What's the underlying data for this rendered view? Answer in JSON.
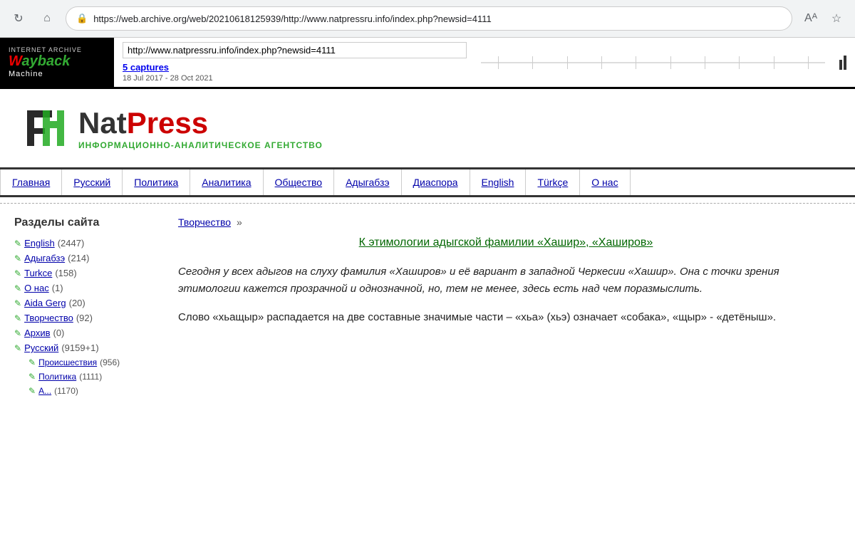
{
  "browser": {
    "url": "https://web.archive.org/web/20210618125939/http://www.natpressru.info/index.php?newsid=4111",
    "address_display": "https://web.archive.org/web/20210618125939/http://www.natpressru.info/index.php?newsid=4111"
  },
  "wayback": {
    "internet_archive": "INTERNET ARCHIVE",
    "logo_w": "W",
    "logo_ayback": "ayback",
    "logo_machine": "Machine",
    "url_field": "http://www.natpressru.info/index.php?newsid=4111",
    "captures_label": "5 captures",
    "date_range": "18 Jul 2017 - 28 Oct 2021"
  },
  "site": {
    "logo_nat": "Nat",
    "logo_press": "Press",
    "subtitle": "ИНФОРМАЦИОННО-АНАЛИТИЧЕСКОЕ АГЕНТСТВО"
  },
  "nav": {
    "items": [
      {
        "label": "Главная"
      },
      {
        "label": "Русский"
      },
      {
        "label": "Политика"
      },
      {
        "label": "Аналитика"
      },
      {
        "label": "Общество"
      },
      {
        "label": "Адыгабзэ"
      },
      {
        "label": "Диаспора"
      },
      {
        "label": "English"
      },
      {
        "label": "Türkçe"
      },
      {
        "label": "О нас"
      }
    ]
  },
  "sidebar": {
    "title": "Разделы сайта",
    "items": [
      {
        "label": "English",
        "count": "(2447)"
      },
      {
        "label": "Адыгабзэ",
        "count": "(214)"
      },
      {
        "label": "Turkce",
        "count": "(158)"
      },
      {
        "label": "О нас",
        "count": "(1)"
      },
      {
        "label": "Aida Gerg",
        "count": "(20)"
      },
      {
        "label": "Творчество",
        "count": "(92)"
      },
      {
        "label": "Архив",
        "count": "(0)"
      },
      {
        "label": "Русский",
        "count": "(9159+1)"
      }
    ],
    "sub_items": [
      {
        "label": "Происшествия",
        "count": "(956)"
      },
      {
        "label": "Политика",
        "count": "(1111)"
      },
      {
        "label": "А...",
        "count": "(1170)"
      }
    ]
  },
  "article": {
    "breadcrumb_link": "Творчество",
    "breadcrumb_sep": "»",
    "title": "К этимологии адыгской фамилии «Хашир», «Хаширов»",
    "para1": "Сегодня у всех адыгов на слуху фамилия «Хаширов» и её вариант в западной Черкесии «Хашир». Она с точки зрения этимологии кажется прозрачной и однозначной, но, тем не менее, здесь есть над чем поразмыслить.",
    "para2": "Слово «хьащыр» распадается на две составные значимые части – «хьа» (хьэ) означает «собака», «щыр» - «детёныш»."
  }
}
